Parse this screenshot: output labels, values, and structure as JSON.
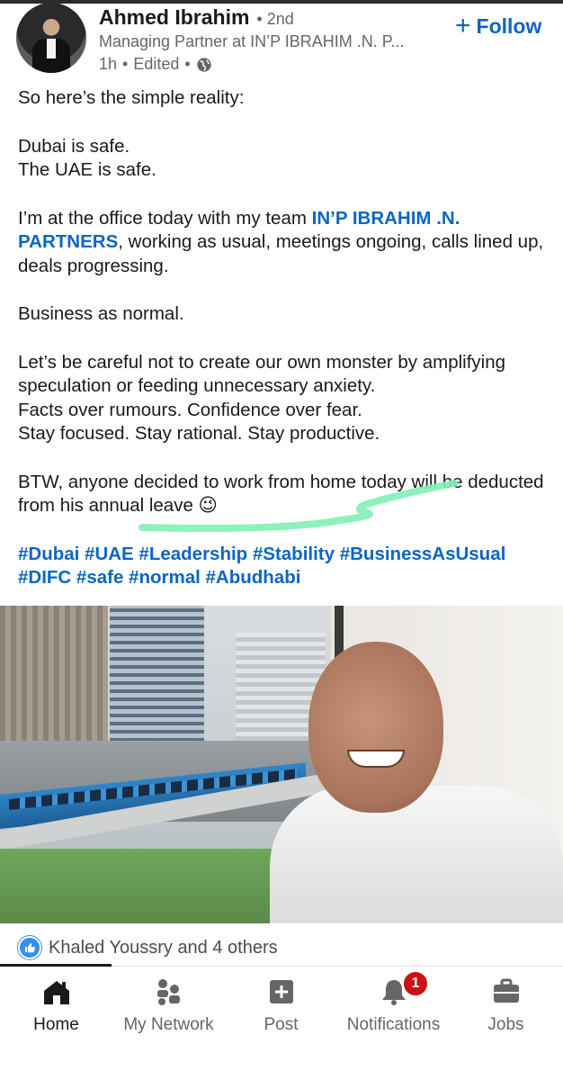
{
  "post": {
    "author": {
      "name": "Ahmed Ibrahim",
      "degree": "2nd",
      "headline": "Managing Partner at IN’P IBRAHIM .N. P...",
      "time": "1h",
      "edited": "Edited",
      "visibility_icon": "globe-icon"
    },
    "follow_label": "Follow",
    "text": {
      "l1": "So here’s the simple reality:",
      "l2": "Dubai is safe.",
      "l3": "The UAE is safe.",
      "p4_before": "I’m at the office today with my team ",
      "p4_mention": "IN’P IBRAHIM .N. PARTNERS",
      "p4_after": ", working as usual, meetings ongoing, calls lined up, deals progressing.",
      "l5": "Business as normal.",
      "p6_a": "Let’s be careful not to create our own monster by amplifying speculation or feeding unnecessary anxiety.",
      "p6_b": "Facts over rumours. Confidence over fear.",
      "p6_c": "Stay focused. Stay rational. Stay productive.",
      "p7": "BTW, anyone decided to work from home today will be deducted from his annual leave 😉",
      "hashtags": "#Dubai #UAE #Leadership #Stability #BusinessAsUsual #DIFC #safe #normal #Abudhabi"
    },
    "reactions": "Khaled Youssry and 4 others"
  },
  "tabs": [
    {
      "label": "Home",
      "icon": "home-icon"
    },
    {
      "label": "My Network",
      "icon": "network-icon"
    },
    {
      "label": "Post",
      "icon": "post-icon"
    },
    {
      "label": "Notifications",
      "icon": "bell-icon",
      "badge": "1"
    },
    {
      "label": "Jobs",
      "icon": "briefcase-icon"
    }
  ],
  "colors": {
    "accent": "#0a66c2",
    "highlight_mark": "#7ff0b4",
    "badge": "#cc1016"
  }
}
